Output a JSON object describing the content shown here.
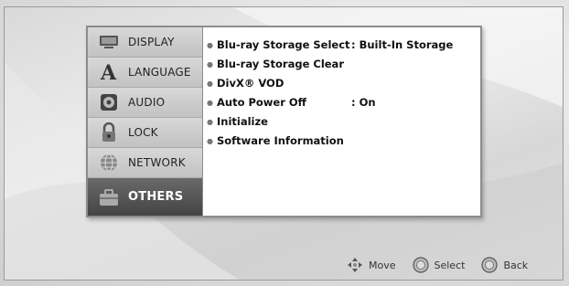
{
  "sidebar": {
    "items": [
      {
        "label": "DISPLAY",
        "icon": "display-icon"
      },
      {
        "label": "LANGUAGE",
        "icon": "language-icon"
      },
      {
        "label": "AUDIO",
        "icon": "audio-icon"
      },
      {
        "label": "LOCK",
        "icon": "lock-icon"
      },
      {
        "label": "NETWORK",
        "icon": "network-icon"
      },
      {
        "label": "OTHERS",
        "icon": "others-icon",
        "active": true
      }
    ]
  },
  "settings": [
    {
      "label": "Blu-ray Storage Select",
      "value": ": Built-In Storage"
    },
    {
      "label": "Blu-ray Storage Clear",
      "value": ""
    },
    {
      "label": "DivX® VOD",
      "value": ""
    },
    {
      "label": "Auto Power Off",
      "value": ": On"
    },
    {
      "label": "Initialize",
      "value": ""
    },
    {
      "label": "Software Information",
      "value": ""
    }
  ],
  "hints": {
    "move": "Move",
    "select": "Select",
    "back": "Back"
  },
  "colors": {
    "active_item": "#4f4f4f",
    "sidebar": "#c6c6c6",
    "panel": "#ffffff"
  }
}
